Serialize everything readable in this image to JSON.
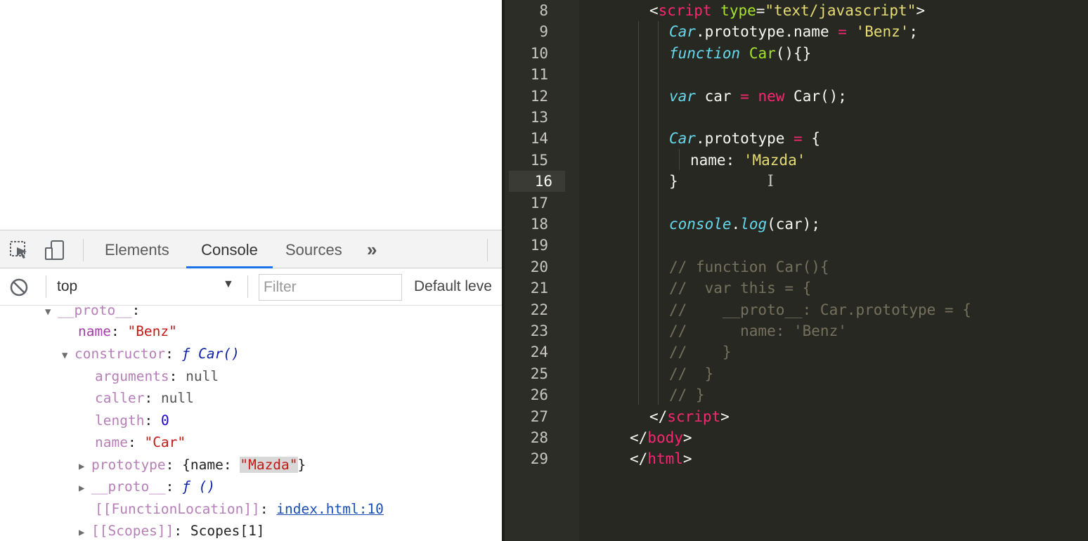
{
  "devtools": {
    "tabs": [
      {
        "label": "Elements"
      },
      {
        "label": "Console"
      },
      {
        "label": "Sources"
      }
    ],
    "more_label": "»",
    "toolbar": {
      "context": "top",
      "filter_placeholder": "Filter",
      "levels": "Default leve"
    }
  },
  "console": {
    "proto_header": "__proto__",
    "name_key": "name",
    "name_value": "\"Benz\"",
    "constructor_key": "constructor",
    "constructor_value": "ƒ Car()",
    "arguments_key": "arguments",
    "arguments_value": "null",
    "caller_key": "caller",
    "caller_value": "null",
    "length_key": "length",
    "length_value": "0",
    "fname_key": "name",
    "fname_value": "\"Car\"",
    "prototype_key": "prototype",
    "prototype_open": "{name: ",
    "prototype_value": "\"Mazda\"",
    "prototype_close": "}",
    "fproto_key": "__proto__",
    "fproto_value": "ƒ ()",
    "location_key": "[[FunctionLocation]]",
    "location_value": "index.html:10",
    "scopes_key": "[[Scopes]]",
    "scopes_value": "Scopes[1]"
  },
  "editor": {
    "line_numbers": [
      "8",
      "9",
      "10",
      "11",
      "12",
      "13",
      "14",
      "15",
      "16",
      "17",
      "18",
      "19",
      "20",
      "21",
      "22",
      "23",
      "24",
      "25",
      "26",
      "27",
      "28",
      "29"
    ],
    "current_line": "16",
    "code": {
      "l8": [
        "<",
        "script",
        " ",
        "type",
        "=",
        "\"text/javascript\"",
        ">"
      ],
      "l9": [
        "Car",
        ".prototype.name ",
        "=",
        " ",
        "'Benz'",
        ";"
      ],
      "l10": [
        "function",
        " ",
        "Car",
        "(){}"
      ],
      "l12": [
        "var",
        " car ",
        "=",
        " ",
        "new",
        " Car();"
      ],
      "l14": [
        "Car",
        ".prototype ",
        "=",
        " {"
      ],
      "l15": [
        "name: ",
        "'Mazda'"
      ],
      "l16": [
        "}"
      ],
      "l18": [
        "console",
        ".",
        "log",
        "(car);"
      ],
      "l20": "// function Car(){",
      "l21": "//  var this = {",
      "l22": "//    __proto__: Car.prototype = {",
      "l23": "//      name: 'Benz'",
      "l24": "//    }",
      "l25": "//  }",
      "l26": "// }",
      "l27": [
        "</",
        "script",
        ">"
      ],
      "l28": [
        "</",
        "body",
        ">"
      ],
      "l29": [
        "</",
        "html",
        ">"
      ]
    }
  },
  "colors": {
    "editor_bg": "#272822",
    "tag": "#f92672",
    "string": "#e6db74",
    "keyword": "#66d9ef",
    "function": "#a6e22e",
    "comment": "#75715e",
    "devtools_active_tab": "#1a73e8"
  }
}
